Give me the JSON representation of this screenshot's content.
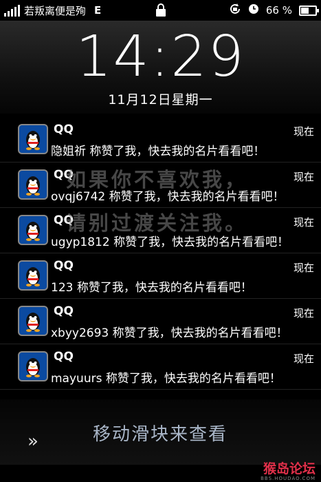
{
  "status_bar": {
    "carrier": "若叛离便是殉",
    "network": "E",
    "battery_percent_text": "66 %",
    "battery_level": 0.66,
    "icons": [
      "signal-bars-icon",
      "lock-icon",
      "rotation-lock-icon",
      "alarm-clock-icon",
      "battery-icon"
    ]
  },
  "lock_screen": {
    "time": "14:29",
    "date": "11月12日星期一"
  },
  "notifications": [
    {
      "app": "QQ",
      "time": "现在",
      "message": "隐姐祈 称赞了我，快去我的名片看看吧！"
    },
    {
      "app": "QQ",
      "time": "现在",
      "message": "ovqj6742 称赞了我，快去我的名片看看吧！"
    },
    {
      "app": "QQ",
      "time": "现在",
      "message": "ugyp1812 称赞了我，快去我的名片看看吧！"
    },
    {
      "app": "QQ",
      "time": "现在",
      "message": "123 称赞了我，快去我的名片看看吧！"
    },
    {
      "app": "QQ",
      "time": "现在",
      "message": "xbyy2693 称赞了我，快去我的名片看看吧！"
    },
    {
      "app": "QQ",
      "time": "现在",
      "message": "mayuurs 称赞了我，快去我的名片看看吧！"
    }
  ],
  "watermark": {
    "line1": "如果你不喜欢我，",
    "line2": "请别过渡关注我。"
  },
  "slider": {
    "label": "移动滑块来查看",
    "arrow": "»"
  },
  "footer": {
    "brand": "猴岛论坛",
    "url": "BBS.HOUDAO.COM"
  },
  "colors": {
    "qq_icon_bg": "#0b4aa0",
    "slider_text": "#a9b6c8",
    "brand": "#e0304a"
  }
}
